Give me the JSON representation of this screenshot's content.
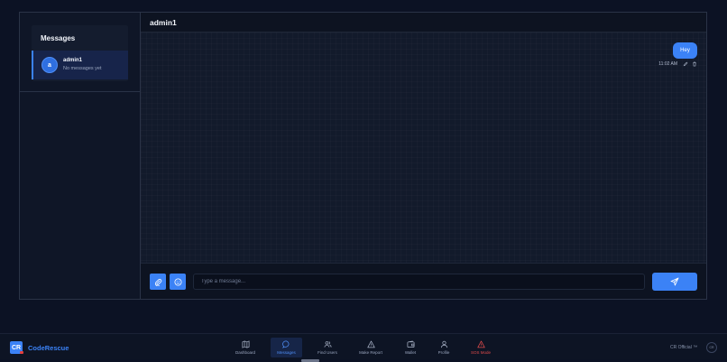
{
  "sidebar": {
    "title": "Messages",
    "conversations": [
      {
        "avatar_letter": "a",
        "name": "admin1",
        "preview": "No messages yet"
      }
    ]
  },
  "chat": {
    "title": "admin1",
    "messages": [
      {
        "text": "Hey",
        "time": "11:02 AM",
        "outgoing": true
      }
    ],
    "input_placeholder": "Type a message...",
    "input_value": ""
  },
  "navbar": {
    "brand_logo": "CR",
    "brand_name": "CodeRescue",
    "items": [
      {
        "label": "Dashboard",
        "icon": "map-icon"
      },
      {
        "label": "Messages",
        "icon": "chat-bubble-icon",
        "active": true
      },
      {
        "label": "Find Users",
        "icon": "users-icon"
      },
      {
        "label": "Make Report",
        "icon": "warning-triangle-icon"
      },
      {
        "label": "Wallet",
        "icon": "wallet-icon"
      },
      {
        "label": "Profile",
        "icon": "user-icon"
      },
      {
        "label": "SOS Mode",
        "icon": "alert-triangle-icon"
      }
    ],
    "official_label": "CR Official ™",
    "official_badge": "CR"
  },
  "colors": {
    "accent": "#3b82f6",
    "background": "#0c1224",
    "sos": "#e24b4b"
  }
}
